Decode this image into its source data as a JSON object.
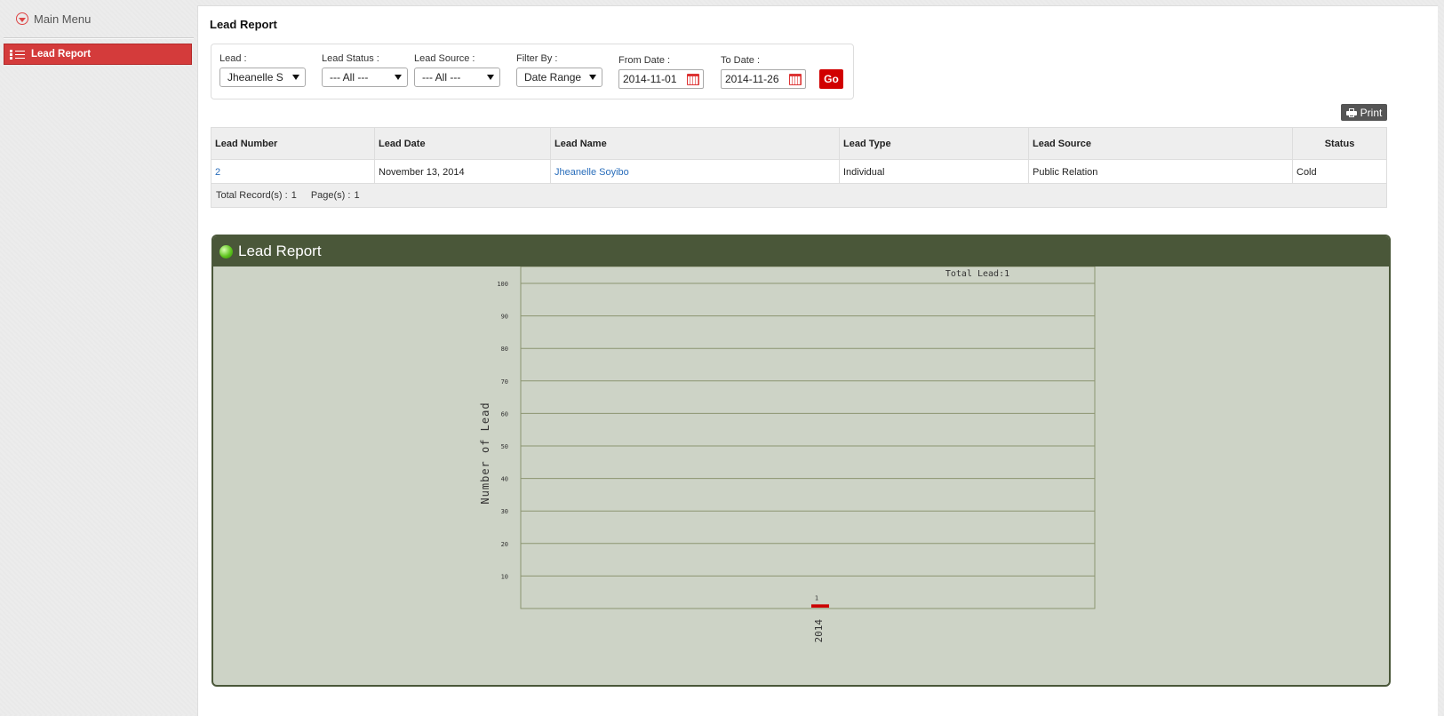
{
  "sidebar": {
    "main_menu_label": "Main Menu",
    "items": [
      {
        "label": "Lead Report",
        "active": true
      }
    ]
  },
  "page": {
    "title": "Lead Report"
  },
  "filters": {
    "lead": {
      "label": "Lead :",
      "value": "Jheanelle S"
    },
    "lead_status": {
      "label": "Lead Status :",
      "value": "--- All ---"
    },
    "lead_source": {
      "label": "Lead Source :",
      "value": "--- All ---"
    },
    "filter_by": {
      "label": "Filter By :",
      "value": "Date Range"
    },
    "from_date": {
      "label": "From Date :",
      "value": "2014-11-01"
    },
    "to_date": {
      "label": "To Date :",
      "value": "2014-11-26"
    },
    "go_label": "Go"
  },
  "print_label": "Print",
  "table": {
    "headers": [
      "Lead Number",
      "Lead Date",
      "Lead Name",
      "Lead Type",
      "Lead Source",
      "Status"
    ],
    "rows": [
      {
        "number": "2",
        "date": "November 13, 2014",
        "name": "Jheanelle Soyibo",
        "type": "Individual",
        "source": "Public Relation",
        "status": "Cold"
      }
    ],
    "footer": {
      "records_label": "Total Record(s) :",
      "records": "1",
      "pages_label": "Page(s) :",
      "pages": "1"
    }
  },
  "chart_panel_title": "Lead Report",
  "colors": {
    "accent_red": "#d43b3b",
    "panel_green": "#4a5739",
    "chart_bg": "#cdd3c6",
    "bar": "#cc0000",
    "link": "#2a6ebb"
  },
  "chart_data": {
    "type": "bar",
    "annotation": "Total Lead:1",
    "ylabel": "Number of Lead",
    "xlabel": "",
    "categories": [
      "2014"
    ],
    "values": [
      1
    ],
    "data_labels": [
      "1"
    ],
    "ylim": [
      0,
      100
    ],
    "yticks": [
      10,
      20,
      30,
      40,
      50,
      60,
      70,
      80,
      90,
      100
    ],
    "grid": true
  }
}
